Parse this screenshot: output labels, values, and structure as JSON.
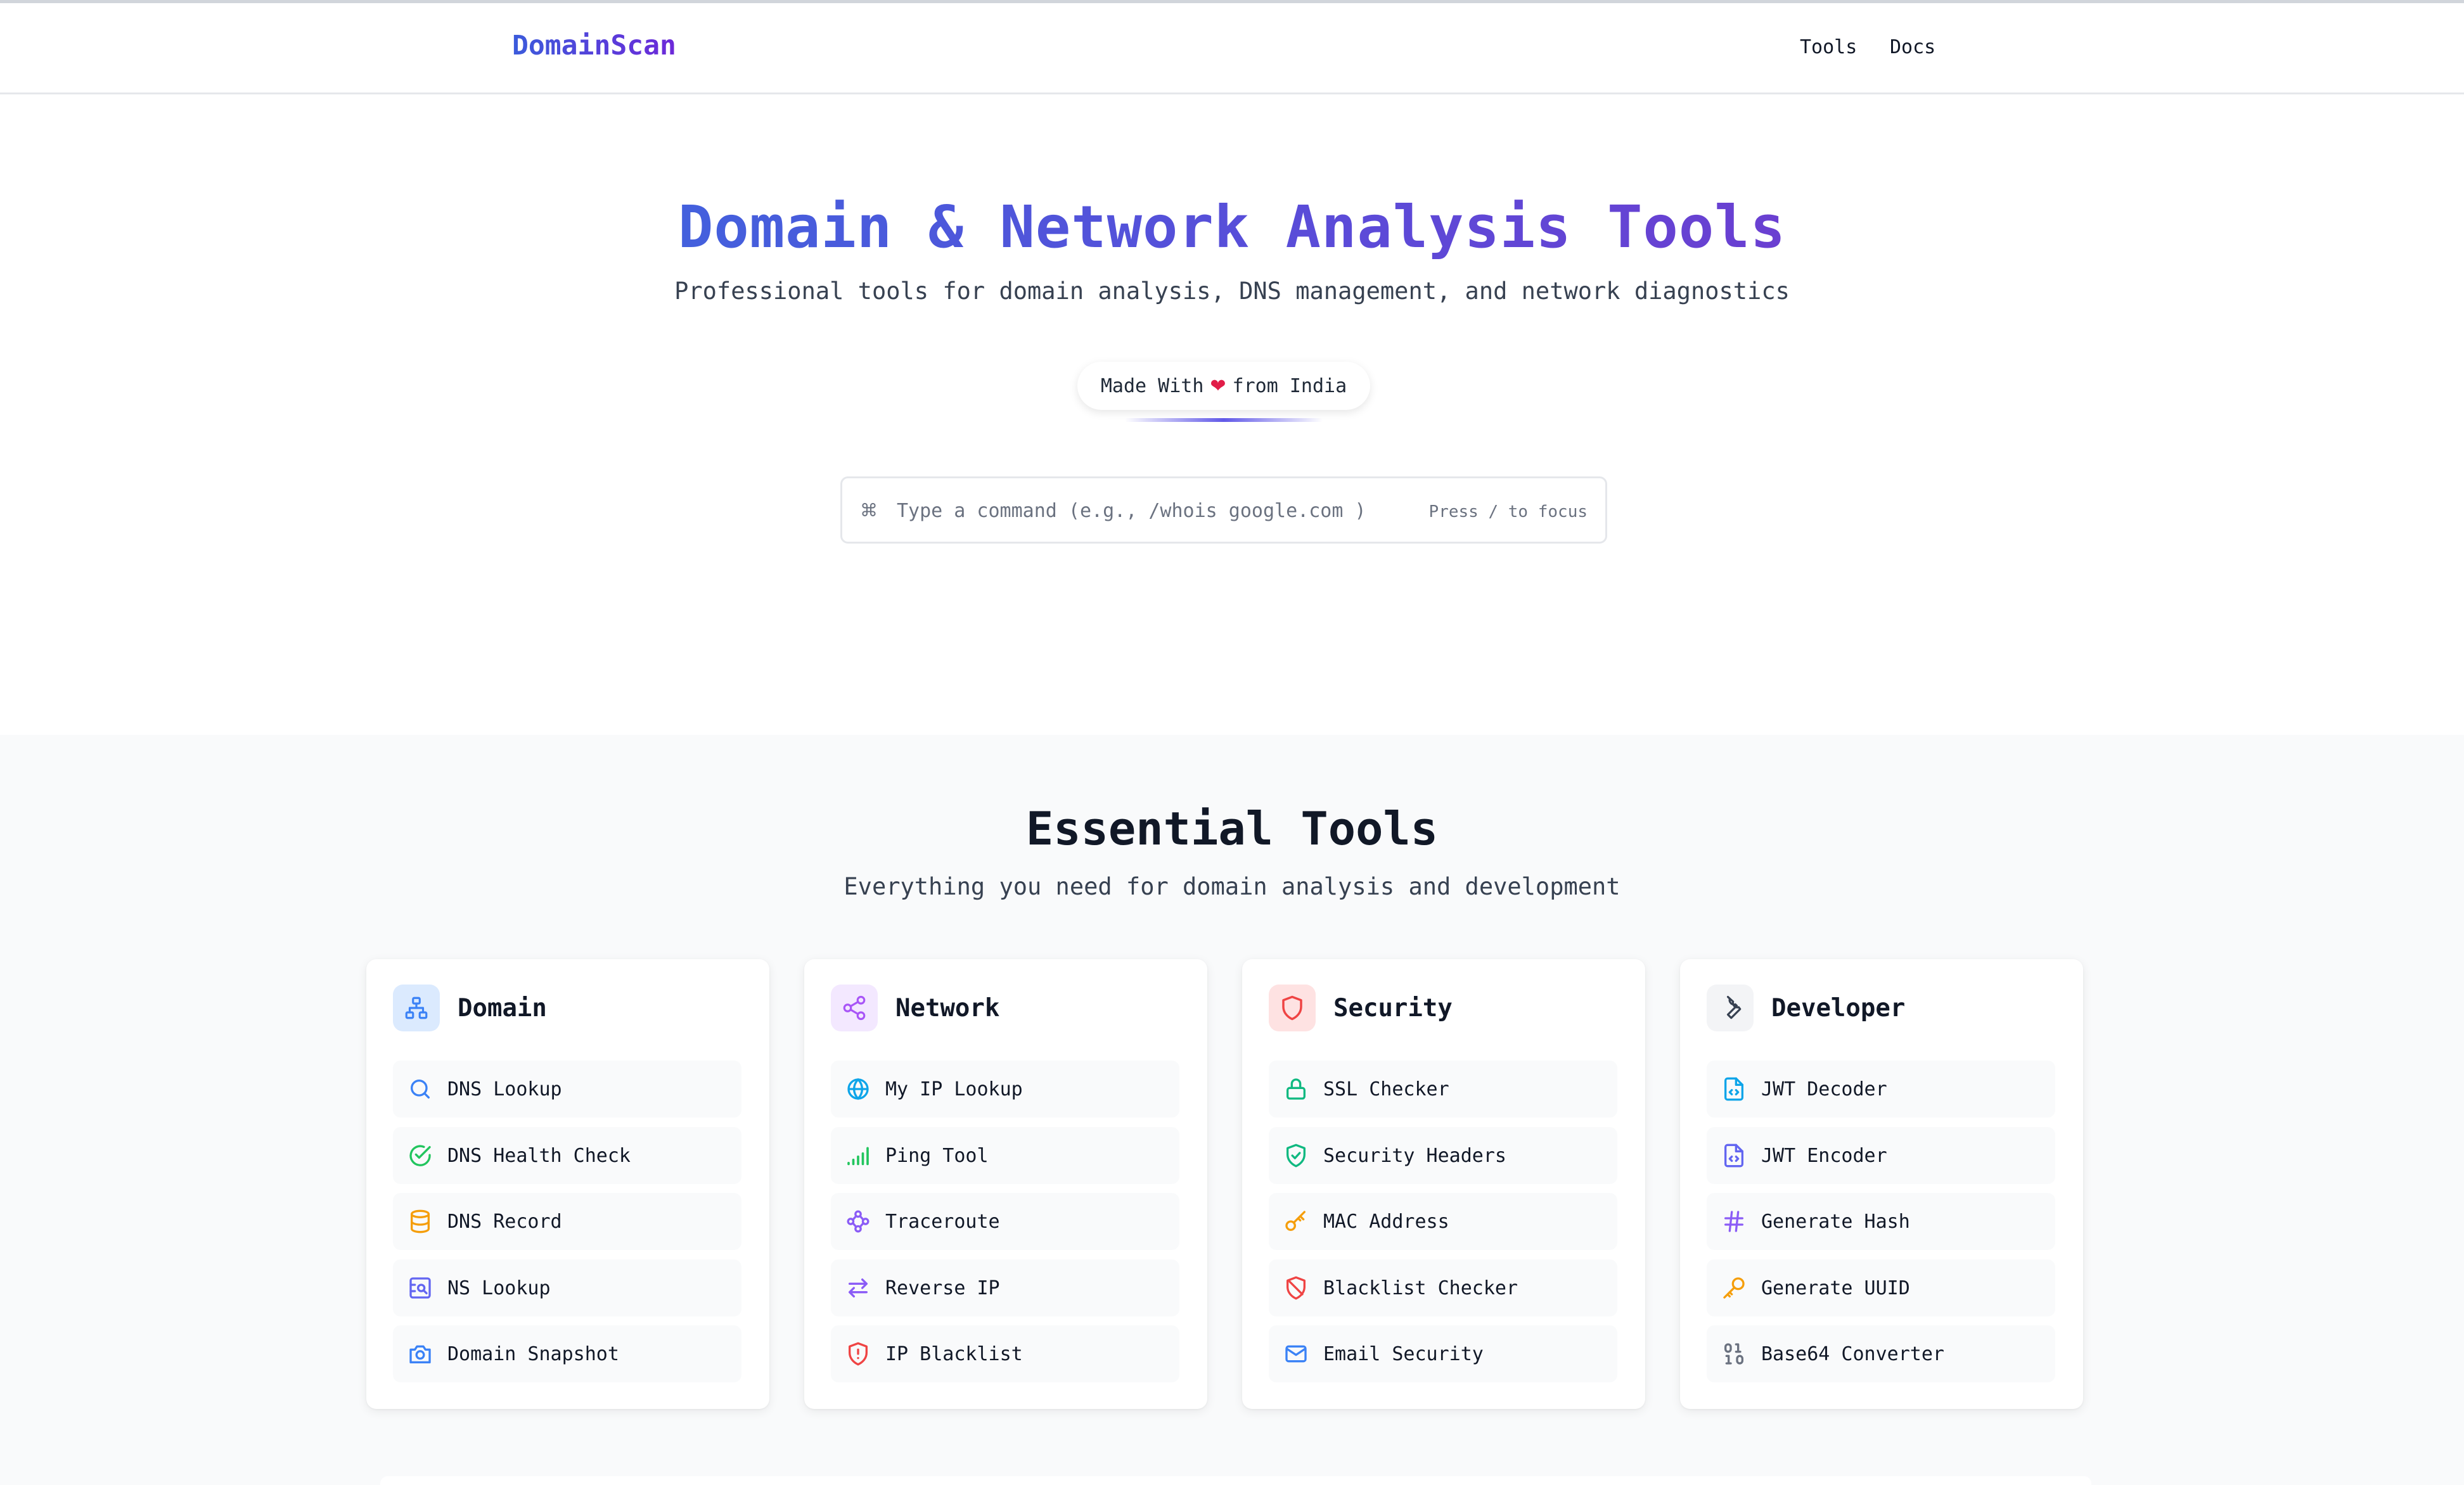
{
  "header": {
    "brand": "DomainScan",
    "nav": [
      {
        "label": "Tools"
      },
      {
        "label": "Docs"
      }
    ]
  },
  "hero": {
    "title": "Domain & Network Analysis Tools",
    "subtitle": "Professional tools for domain analysis, DNS management, and network diagnostics",
    "made_with": {
      "prefix": "Made With",
      "suffix": "from India",
      "icon": "heart-icon"
    },
    "command": {
      "icon": "command-icon",
      "placeholder": "Type a command (e.g., /whois google.com )",
      "value": "",
      "hint": "Press / to focus"
    }
  },
  "tools": {
    "title": "Essential Tools",
    "subtitle": "Everything you need for domain analysis and development",
    "categories": [
      {
        "title": "Domain",
        "icon": "sitemap-icon",
        "color": "#3b82f6",
        "bg": "#dbeafe",
        "items": [
          {
            "label": "DNS Lookup",
            "icon": "search-icon",
            "color": "#3b82f6"
          },
          {
            "label": "DNS Health Check",
            "icon": "check-circle-icon",
            "color": "#22c55e"
          },
          {
            "label": "DNS Record",
            "icon": "database-icon",
            "color": "#f59e0b"
          },
          {
            "label": "NS Lookup",
            "icon": "server-icon",
            "color": "#6366f1"
          },
          {
            "label": "Domain Snapshot",
            "icon": "camera-icon",
            "color": "#3b82f6"
          }
        ]
      },
      {
        "title": "Network",
        "icon": "share-icon",
        "color": "#a855f7",
        "bg": "#f3e8ff",
        "items": [
          {
            "label": "My IP Lookup",
            "icon": "globe-icon",
            "color": "#0ea5e9"
          },
          {
            "label": "Ping Tool",
            "icon": "signal-icon",
            "color": "#22c55e"
          },
          {
            "label": "Traceroute",
            "icon": "route-icon",
            "color": "#8b5cf6"
          },
          {
            "label": "Reverse IP",
            "icon": "arrows-swap-icon",
            "color": "#8b5cf6"
          },
          {
            "label": "IP Blacklist",
            "icon": "shield-alert-icon",
            "color": "#ef4444"
          }
        ]
      },
      {
        "title": "Security",
        "icon": "shield-icon",
        "color": "#ef4444",
        "bg": "#fee2e2",
        "items": [
          {
            "label": "SSL Checker",
            "icon": "lock-icon",
            "color": "#10b981"
          },
          {
            "label": "Security Headers",
            "icon": "shield-check-icon",
            "color": "#10b981"
          },
          {
            "label": "MAC Address",
            "icon": "key-icon",
            "color": "#f59e0b"
          },
          {
            "label": "Blacklist Checker",
            "icon": "shield-off-icon",
            "color": "#ef4444"
          },
          {
            "label": "Email Security",
            "icon": "mail-icon",
            "color": "#3b82f6"
          }
        ]
      },
      {
        "title": "Developer",
        "icon": "wrench-icon",
        "color": "#374151",
        "bg": "#f3f4f6",
        "items": [
          {
            "label": "JWT Decoder",
            "icon": "file-code-icon",
            "color": "#0ea5e9"
          },
          {
            "label": "JWT Encoder",
            "icon": "file-code-icon",
            "color": "#6366f1"
          },
          {
            "label": "Generate Hash",
            "icon": "hash-icon",
            "color": "#8b5cf6"
          },
          {
            "label": "Generate UUID",
            "icon": "key-icon",
            "color": "#f59e0b"
          },
          {
            "label": "Base64 Converter",
            "icon": "binary-icon",
            "color": "#6b7280"
          }
        ]
      }
    ]
  }
}
